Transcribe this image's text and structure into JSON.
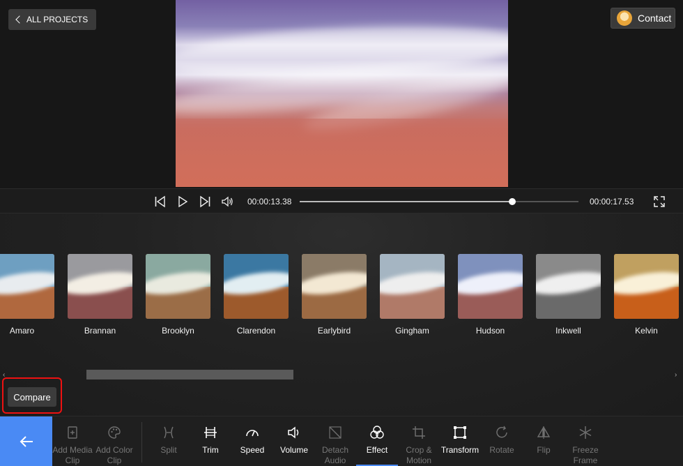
{
  "header": {
    "back_label": "ALL PROJECTS",
    "contact_label": "Contact"
  },
  "transport": {
    "current_time": "00:00:13.38",
    "total_time": "00:00:17.53",
    "progress_fraction": 0.763
  },
  "filters": [
    {
      "name": "Amaro",
      "water": "#6e9fc1",
      "wave": "#e8ecef",
      "land": "#b0683e"
    },
    {
      "name": "Brannan",
      "water": "#9a9a9e",
      "wave": "#f3eee4",
      "land": "#8a4f4e"
    },
    {
      "name": "Brooklyn",
      "water": "#8aa9a0",
      "wave": "#e9eadf",
      "land": "#9b6d47"
    },
    {
      "name": "Clarendon",
      "water": "#3b78a2",
      "wave": "#e2eef2",
      "land": "#9d5a2c"
    },
    {
      "name": "Earlybird",
      "water": "#8b7b67",
      "wave": "#f3e8d3",
      "land": "#9c6a43"
    },
    {
      "name": "Gingham",
      "water": "#a5b5c2",
      "wave": "#eeeeee",
      "land": "#b07a68"
    },
    {
      "name": "Hudson",
      "water": "#7f91bd",
      "wave": "#eef0fa",
      "land": "#9a5c58"
    },
    {
      "name": "Inkwell",
      "water": "#8a8a8a",
      "wave": "#efefef",
      "land": "#6a6a6a"
    },
    {
      "name": "Kelvin",
      "water": "#c0a060",
      "wave": "#f9f0d8",
      "land": "#c85f1a"
    }
  ],
  "compare_label": "Compare",
  "toolbar": {
    "tools": [
      {
        "id": "add-media-clip",
        "label": "Add Media Clip",
        "state": "dim"
      },
      {
        "id": "add-color-clip",
        "label": "Add Color Clip",
        "state": "dim"
      },
      {
        "id": "split",
        "label": "Split",
        "state": "dim"
      },
      {
        "id": "trim",
        "label": "Trim",
        "state": "on"
      },
      {
        "id": "speed",
        "label": "Speed",
        "state": "on"
      },
      {
        "id": "volume",
        "label": "Volume",
        "state": "on"
      },
      {
        "id": "detach-audio",
        "label": "Detach Audio",
        "state": "dim"
      },
      {
        "id": "effect",
        "label": "Effect",
        "state": "active"
      },
      {
        "id": "crop-motion",
        "label": "Crop & Motion",
        "state": "dim"
      },
      {
        "id": "transform",
        "label": "Transform",
        "state": "on"
      },
      {
        "id": "rotate",
        "label": "Rotate",
        "state": "dim"
      },
      {
        "id": "flip",
        "label": "Flip",
        "state": "dim"
      },
      {
        "id": "freeze-frame",
        "label": "Freeze Frame",
        "state": "dim"
      }
    ]
  },
  "colors": {
    "accent": "#4a8af4",
    "highlight": "#e11111"
  }
}
